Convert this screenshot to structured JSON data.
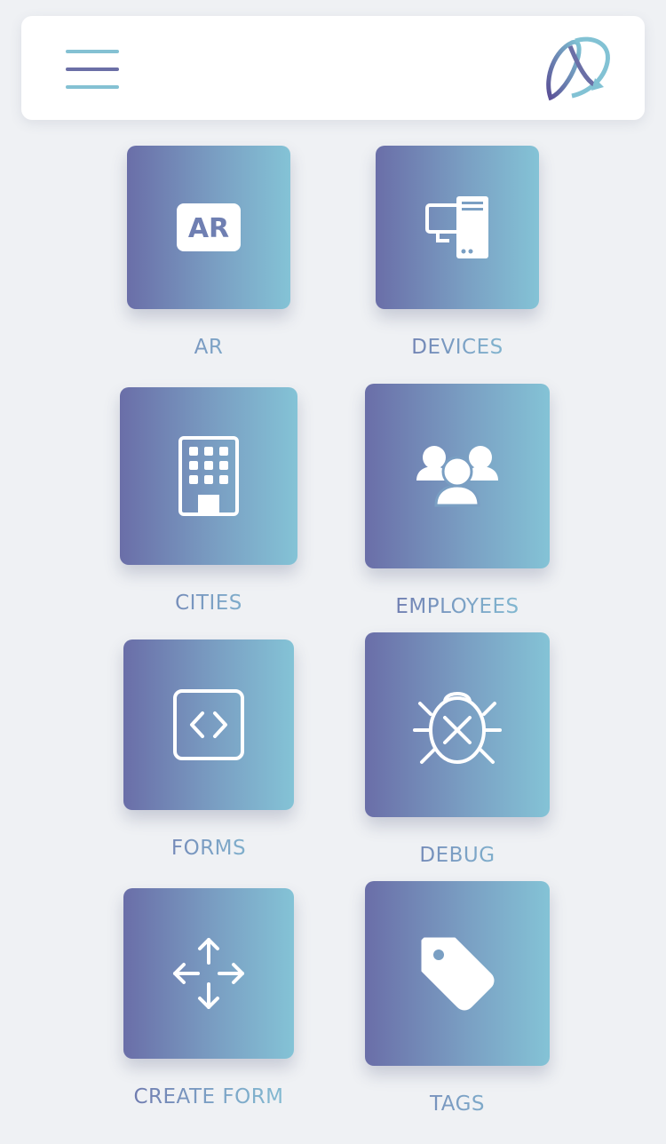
{
  "header": {
    "menu_icon": "hamburger-menu-icon",
    "logo_icon": "app-logo-icon"
  },
  "colors": {
    "gradient_start": "#6a6ea8",
    "gradient_end": "#84c3d6",
    "background": "#eff1f4",
    "card": "#ffffff"
  },
  "tiles": [
    {
      "label": "AR",
      "icon": "ar-badge-icon",
      "badge_text": "AR"
    },
    {
      "label": "DEVICES",
      "icon": "devices-icon"
    },
    {
      "label": "CITIES",
      "icon": "building-icon"
    },
    {
      "label": "EMPLOYEES",
      "icon": "users-group-icon"
    },
    {
      "label": "FORMS",
      "icon": "code-brackets-icon"
    },
    {
      "label": "DEBUG",
      "icon": "bug-icon"
    },
    {
      "label": "CREATE FORM",
      "icon": "move-arrows-icon"
    },
    {
      "label": "TAGS",
      "icon": "tag-icon"
    }
  ]
}
